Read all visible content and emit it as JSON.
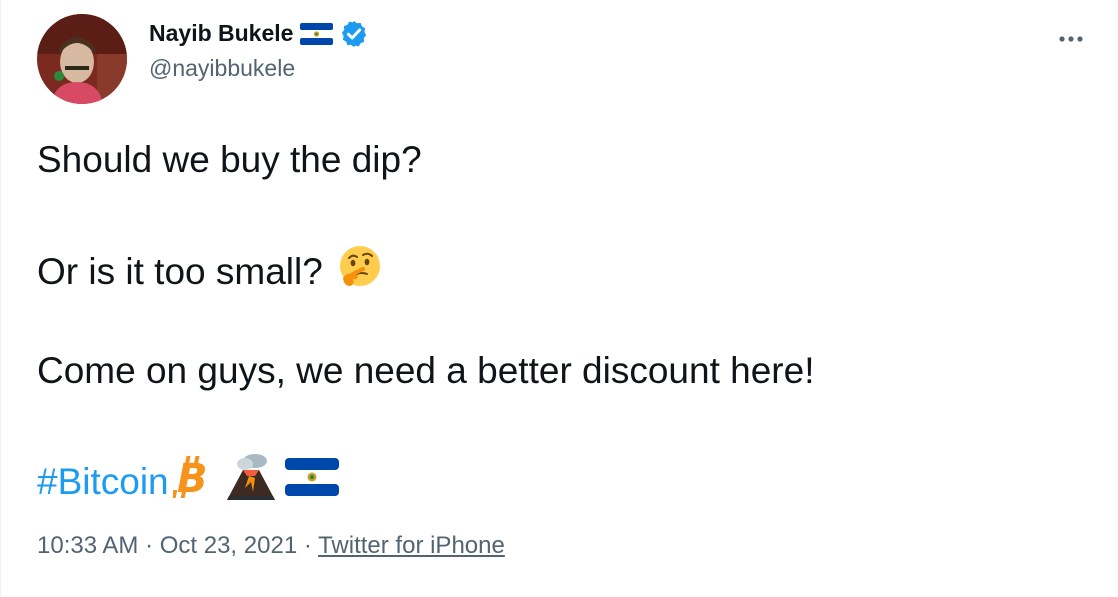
{
  "author": {
    "display_name": "Nayib Bukele",
    "handle": "@nayibbukele",
    "verified": true,
    "flag_emoji": "el-salvador-flag"
  },
  "menu": {
    "more_icon": "more-horizontal-icon"
  },
  "tweet": {
    "line1": "Should we buy the dip?",
    "line2": "Or is it too small?",
    "line2_emoji": "thinking-face",
    "line3": "Come on guys, we need a better discount here!",
    "hashtag": "#Bitcoin",
    "trailing_emojis": [
      "bitcoin-symbol",
      "volcano",
      "el-salvador-flag"
    ]
  },
  "meta": {
    "time": "10:33 AM",
    "separator1": " · ",
    "date": "Oct 23, 2021",
    "separator2": " · ",
    "source": "Twitter for iPhone"
  },
  "colors": {
    "link": "#1d9bf0",
    "secondary_text": "#536471",
    "primary_text": "#0f1419",
    "bitcoin_orange": "#f7931a",
    "flag_blue": "#0047ab"
  }
}
